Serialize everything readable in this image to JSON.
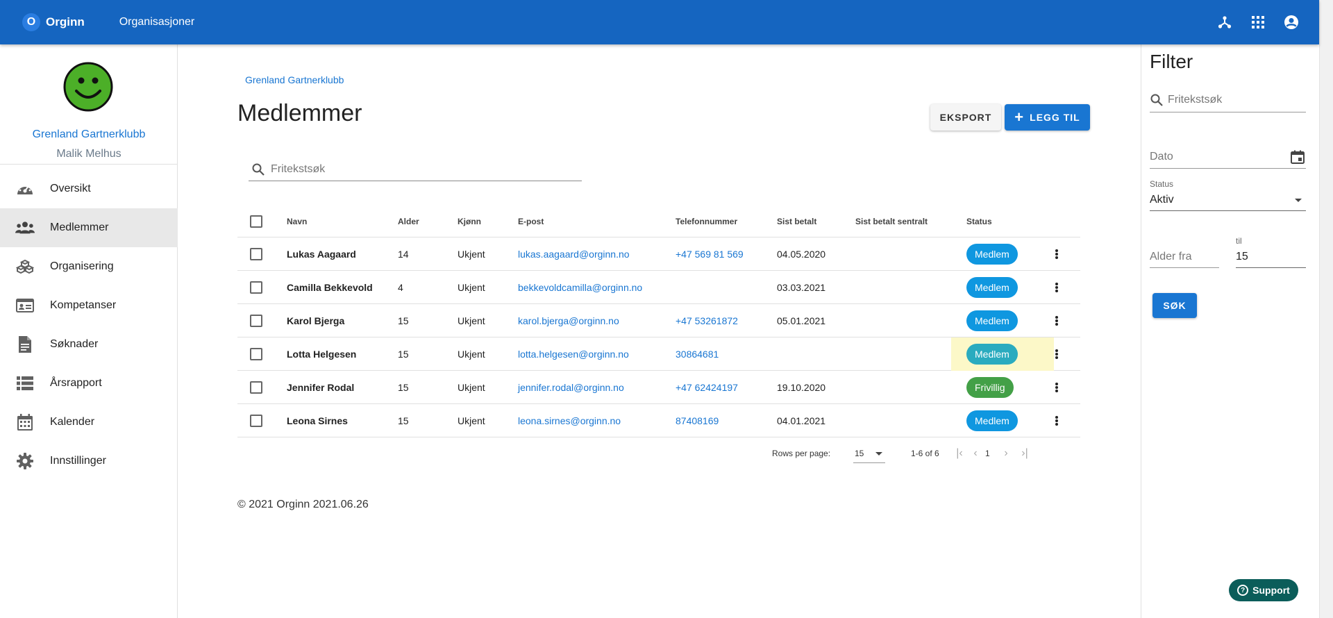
{
  "app": {
    "brand_letter": "O",
    "brand_name": "Orginn",
    "nav_organisations": "Organisasjoner",
    "icons": [
      "network-icon",
      "apps-grid-icon",
      "account-circle-icon"
    ]
  },
  "sidebar": {
    "org_name": "Grenland Gartnerklubb",
    "user_name": "Malik Melhus",
    "items": [
      {
        "label": "Oversikt",
        "icon": "speedometer-icon"
      },
      {
        "label": "Medlemmer",
        "icon": "people-icon",
        "active": true
      },
      {
        "label": "Organisering",
        "icon": "boxes-icon"
      },
      {
        "label": "Kompetanser",
        "icon": "id-card-icon"
      },
      {
        "label": "Søknader",
        "icon": "document-icon"
      },
      {
        "label": "Årsrapport",
        "icon": "list-icon"
      },
      {
        "label": "Kalender",
        "icon": "calendar-icon"
      },
      {
        "label": "Innstillinger",
        "icon": "gear-icon"
      }
    ]
  },
  "main": {
    "breadcrumb": "Grenland Gartnerklubb",
    "title": "Medlemmer",
    "export_label": "EKSPORT",
    "add_label": "LEGG TIL",
    "search_placeholder": "Fritekstsøk",
    "columns": {
      "name": "Navn",
      "age": "Alder",
      "gender": "Kjønn",
      "email": "E-post",
      "phone": "Telefonnummer",
      "last_paid": "Sist betalt",
      "last_paid_central": "Sist betalt sentralt",
      "status": "Status"
    },
    "rows": [
      {
        "name": "Lukas Aagaard",
        "age": "14",
        "gender": "Ukjent",
        "email": "lukas.aagaard@orginn.no",
        "phone": "+47 569 81 569",
        "last_paid": "04.05.2020",
        "last_paid_central": "",
        "status": "Medlem"
      },
      {
        "name": "Camilla Bekkevold",
        "age": "4",
        "gender": "Ukjent",
        "email": "bekkevoldcamilla@orginn.no",
        "phone": "",
        "last_paid": "03.03.2021",
        "last_paid_central": "",
        "status": "Medlem"
      },
      {
        "name": "Karol Bjerga",
        "age": "15",
        "gender": "Ukjent",
        "email": "karol.bjerga@orginn.no",
        "phone": "+47 53261872",
        "last_paid": "05.01.2021",
        "last_paid_central": "",
        "status": "Medlem"
      },
      {
        "name": "Lotta Helgesen",
        "age": "15",
        "gender": "Ukjent",
        "email": "lotta.helgesen@orginn.no",
        "phone": "30864681",
        "last_paid": "",
        "last_paid_central": "",
        "status": "Medlem"
      },
      {
        "name": "Jennifer Rodal",
        "age": "15",
        "gender": "Ukjent",
        "email": "jennifer.rodal@orginn.no",
        "phone": "+47 62424197",
        "last_paid": "19.10.2020",
        "last_paid_central": "",
        "status": "Frivillig"
      },
      {
        "name": "Leona Sirnes",
        "age": "15",
        "gender": "Ukjent",
        "email": "leona.sirnes@orginn.no",
        "phone": "87408169",
        "last_paid": "04.01.2021",
        "last_paid_central": "",
        "status": "Medlem"
      }
    ],
    "pagination": {
      "rows_per_page_label": "Rows per page:",
      "rows_per_page": "15",
      "range": "1-6 of 6",
      "page": "1"
    },
    "footer": "© 2021 Orginn 2021.06.26"
  },
  "filter": {
    "title": "Filter",
    "search_placeholder": "Fritekstsøk",
    "date_placeholder": "Dato",
    "status_label": "Status",
    "status_value": "Aktiv",
    "age_from_placeholder": "Alder fra",
    "age_to_label": "til",
    "age_to_value": "15",
    "search_button": "SØK"
  },
  "support_label": "Support",
  "colors": {
    "topbar": "#1565c0",
    "primary": "#1976d2",
    "badge_member": "#0f97e0",
    "badge_member_hover": "#2aabbf",
    "badge_volunteer": "#43a047",
    "row_highlight": "#fcf8c8",
    "support": "#0b5d5a"
  }
}
